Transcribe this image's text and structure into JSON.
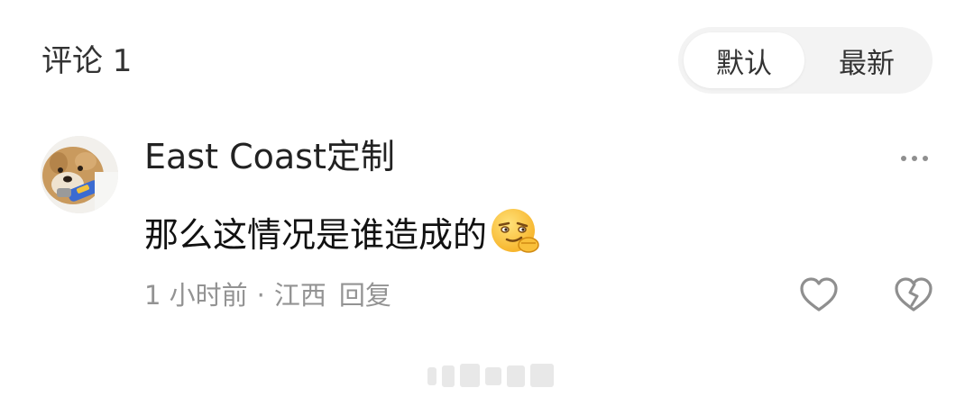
{
  "header": {
    "title": "评论 1"
  },
  "sort": {
    "options": [
      "默认",
      "最新"
    ],
    "selected": "默认"
  },
  "comment": {
    "username": "East Coast定制",
    "text": "那么这情况是谁造成的",
    "emoji": "smirk-emoji",
    "time": "1 小时前",
    "separator": "·",
    "location": "江西",
    "reply_label": "回复"
  },
  "icons": {
    "more": "more-dots-icon",
    "like": "heart-outline-icon",
    "dislike": "broken-heart-icon"
  },
  "colors": {
    "background": "#ffffff",
    "toggle_bg": "#f3f3f3",
    "meta_text": "#939393",
    "icon_stroke": "#8f8f8f"
  }
}
